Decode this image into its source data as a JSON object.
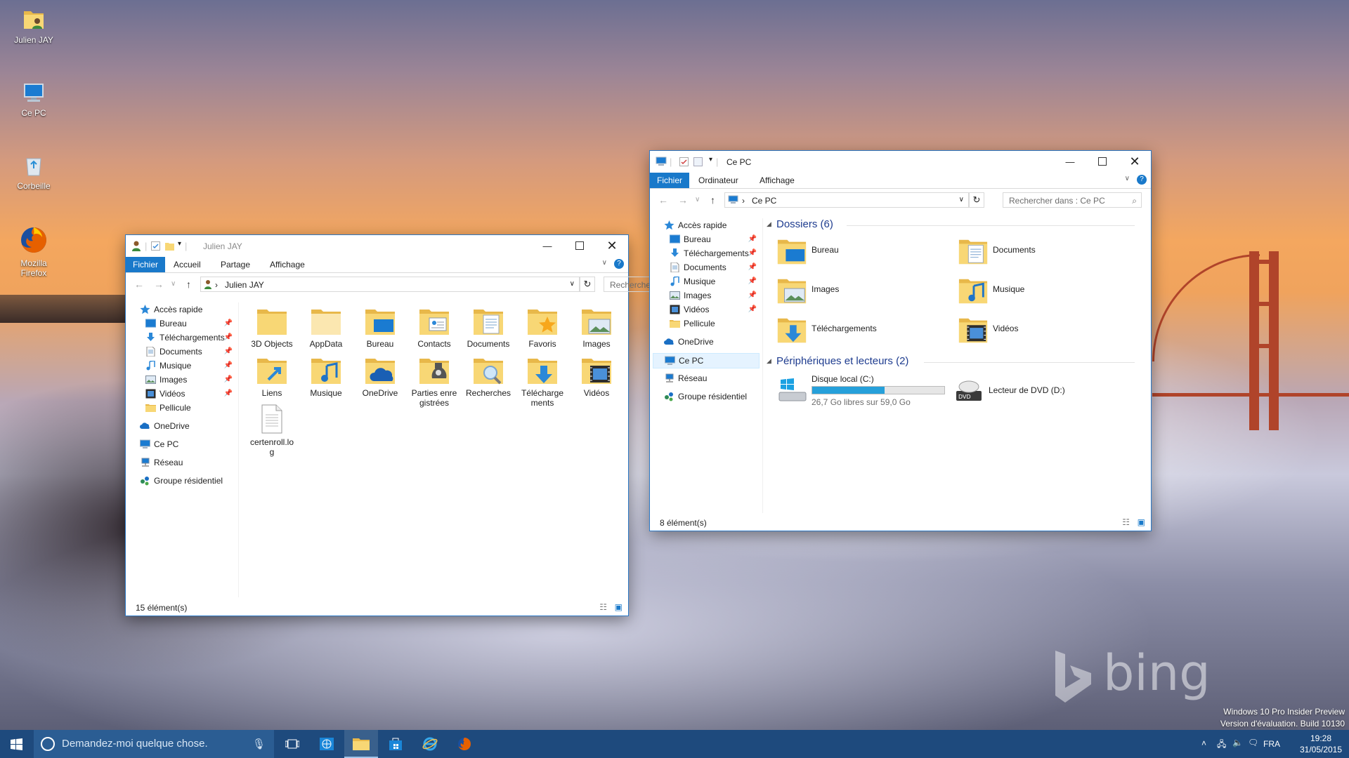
{
  "desktop": {
    "icons": [
      {
        "label": "Julien JAY"
      },
      {
        "label": "Ce PC"
      },
      {
        "label": "Corbeille"
      },
      {
        "label": "Mozilla Firefox"
      }
    ],
    "branding": "bing",
    "watermark": [
      "Windows 10 Pro Insider Preview",
      "Version d'évaluation. Build 10130"
    ]
  },
  "window_left": {
    "title": "Julien JAY",
    "tabs": [
      "Fichier",
      "Accueil",
      "Partage",
      "Affichage"
    ],
    "address": "Julien JAY",
    "search_placeholder": "Rechercher dans : Julien JAY",
    "nav": [
      {
        "label": "Accès rapide",
        "icon": "star-icon"
      },
      {
        "label": "Bureau",
        "icon": "desktop-icon",
        "pinned": true
      },
      {
        "label": "Téléchargements",
        "icon": "download-icon",
        "pinned": true
      },
      {
        "label": "Documents",
        "icon": "document-icon",
        "pinned": true
      },
      {
        "label": "Musique",
        "icon": "music-icon",
        "pinned": true
      },
      {
        "label": "Images",
        "icon": "image-icon",
        "pinned": true
      },
      {
        "label": "Vidéos",
        "icon": "video-icon",
        "pinned": true
      },
      {
        "label": "Pellicule",
        "icon": "folder-icon"
      },
      {
        "label": "OneDrive",
        "icon": "cloud-icon"
      },
      {
        "label": "Ce PC",
        "icon": "computer-icon"
      },
      {
        "label": "Réseau",
        "icon": "network-icon"
      },
      {
        "label": "Groupe résidentiel",
        "icon": "homegroup-icon"
      }
    ],
    "items": [
      "3D Objects",
      "AppData",
      "Bureau",
      "Contacts",
      "Documents",
      "Favoris",
      "Images",
      "Liens",
      "Musique",
      "OneDrive",
      "Parties enregistrées",
      "Recherches",
      "Téléchargements",
      "Vidéos",
      "certenroll.log"
    ],
    "status": "15 élément(s)"
  },
  "window_right": {
    "title": "Ce PC",
    "tabs": [
      "Fichier",
      "Ordinateur",
      "Affichage"
    ],
    "address": "Ce PC",
    "search_placeholder": "Rechercher dans : Ce PC",
    "nav": [
      {
        "label": "Accès rapide",
        "icon": "star-icon"
      },
      {
        "label": "Bureau",
        "icon": "desktop-icon",
        "pinned": true
      },
      {
        "label": "Téléchargements",
        "icon": "download-icon",
        "pinned": true
      },
      {
        "label": "Documents",
        "icon": "document-icon",
        "pinned": true
      },
      {
        "label": "Musique",
        "icon": "music-icon",
        "pinned": true
      },
      {
        "label": "Images",
        "icon": "image-icon",
        "pinned": true
      },
      {
        "label": "Vidéos",
        "icon": "video-icon",
        "pinned": true
      },
      {
        "label": "Pellicule",
        "icon": "folder-icon"
      },
      {
        "label": "OneDrive",
        "icon": "cloud-icon"
      },
      {
        "label": "Ce PC",
        "icon": "computer-icon",
        "selected": true
      },
      {
        "label": "Réseau",
        "icon": "network-icon"
      },
      {
        "label": "Groupe résidentiel",
        "icon": "homegroup-icon"
      }
    ],
    "folders_header": "Dossiers (6)",
    "folders": [
      "Bureau",
      "Documents",
      "Images",
      "Musique",
      "Téléchargements",
      "Vidéos"
    ],
    "devices_header": "Périphériques et lecteurs (2)",
    "drive_c": {
      "label": "Disque local (C:)",
      "free": "26,7 Go libres sur 59,0 Go",
      "used_fraction": 0.55
    },
    "drive_d": {
      "label": "Lecteur de DVD (D:)"
    },
    "status": "8 élément(s)"
  },
  "taskbar": {
    "search_placeholder": "Demandez-moi quelque chose.",
    "language": "FRA",
    "time": "19:28",
    "date": "31/05/2015"
  },
  "colors": {
    "accent": "#1979ca",
    "taskbar": "#1e4a7d",
    "folder": "#f8d775",
    "drive_bar": "#26a0da"
  }
}
